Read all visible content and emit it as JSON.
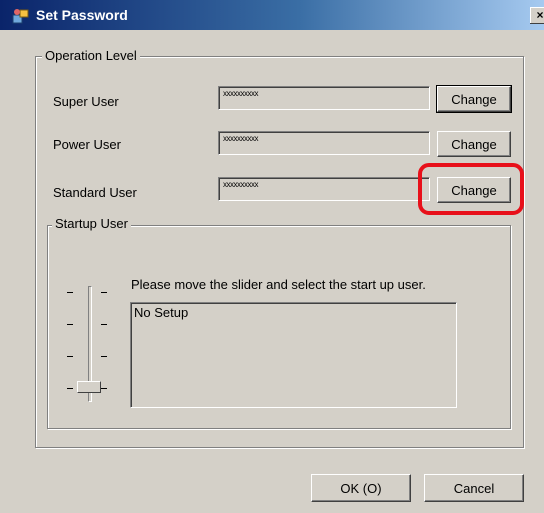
{
  "window": {
    "title": "Set Password",
    "close_label": "×"
  },
  "operation_level": {
    "legend": "Operation Level",
    "rows": [
      {
        "label": "Super User",
        "password": "xxxxxxxxxx",
        "button": "Change"
      },
      {
        "label": "Power User",
        "password": "xxxxxxxxxx",
        "button": "Change"
      },
      {
        "label": "Standard User",
        "password": "xxxxxxxxxx",
        "button": "Change"
      }
    ]
  },
  "startup_user": {
    "legend": "Startup User",
    "instruction": "Please move the slider and select the start up user.",
    "list_value": "No Setup",
    "slider_position": 0
  },
  "footer": {
    "ok_label": "OK (O)",
    "cancel_label": "Cancel"
  },
  "colors": {
    "title_gradient_start": "#0a246a",
    "title_gradient_end": "#a6caf0",
    "dialog_bg": "#d4d0c8",
    "highlight": "#e8101a"
  }
}
